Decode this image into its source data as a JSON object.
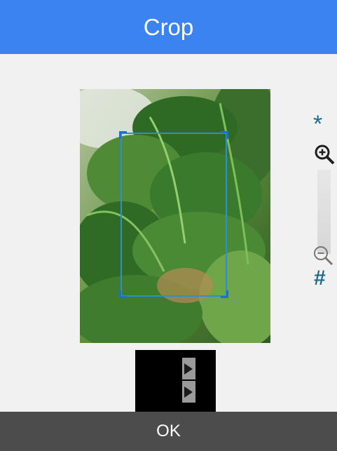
{
  "header": {
    "title": "Crop"
  },
  "zoom": {
    "top_symbol": "*",
    "bottom_symbol": "#",
    "zoom_in_icon": "zoom-in-icon",
    "zoom_out_icon": "zoom-out-icon"
  },
  "rotate": {
    "icon": "rotate-icon"
  },
  "footer": {
    "ok_label": "OK"
  },
  "colors": {
    "header": "#3a83f0",
    "footer": "#4c4c4c",
    "crop_frame": "#2a8fd6",
    "zoom_symbols": "#1f6b8c"
  }
}
